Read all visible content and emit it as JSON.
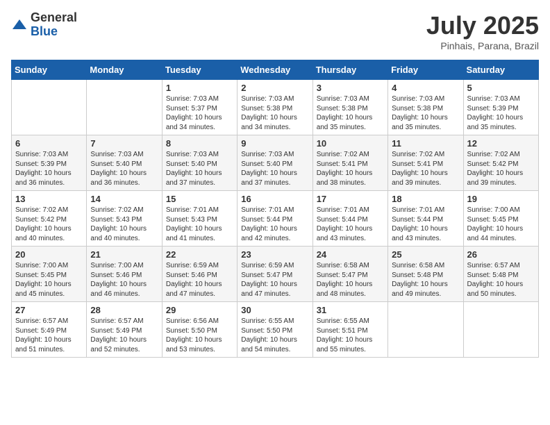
{
  "logo": {
    "general": "General",
    "blue": "Blue"
  },
  "title": "July 2025",
  "subtitle": "Pinhais, Parana, Brazil",
  "days_of_week": [
    "Sunday",
    "Monday",
    "Tuesday",
    "Wednesday",
    "Thursday",
    "Friday",
    "Saturday"
  ],
  "weeks": [
    [
      {
        "day": "",
        "info": ""
      },
      {
        "day": "",
        "info": ""
      },
      {
        "day": "1",
        "info": "Sunrise: 7:03 AM\nSunset: 5:37 PM\nDaylight: 10 hours and 34 minutes."
      },
      {
        "day": "2",
        "info": "Sunrise: 7:03 AM\nSunset: 5:38 PM\nDaylight: 10 hours and 34 minutes."
      },
      {
        "day": "3",
        "info": "Sunrise: 7:03 AM\nSunset: 5:38 PM\nDaylight: 10 hours and 35 minutes."
      },
      {
        "day": "4",
        "info": "Sunrise: 7:03 AM\nSunset: 5:38 PM\nDaylight: 10 hours and 35 minutes."
      },
      {
        "day": "5",
        "info": "Sunrise: 7:03 AM\nSunset: 5:39 PM\nDaylight: 10 hours and 35 minutes."
      }
    ],
    [
      {
        "day": "6",
        "info": "Sunrise: 7:03 AM\nSunset: 5:39 PM\nDaylight: 10 hours and 36 minutes."
      },
      {
        "day": "7",
        "info": "Sunrise: 7:03 AM\nSunset: 5:40 PM\nDaylight: 10 hours and 36 minutes."
      },
      {
        "day": "8",
        "info": "Sunrise: 7:03 AM\nSunset: 5:40 PM\nDaylight: 10 hours and 37 minutes."
      },
      {
        "day": "9",
        "info": "Sunrise: 7:03 AM\nSunset: 5:40 PM\nDaylight: 10 hours and 37 minutes."
      },
      {
        "day": "10",
        "info": "Sunrise: 7:02 AM\nSunset: 5:41 PM\nDaylight: 10 hours and 38 minutes."
      },
      {
        "day": "11",
        "info": "Sunrise: 7:02 AM\nSunset: 5:41 PM\nDaylight: 10 hours and 39 minutes."
      },
      {
        "day": "12",
        "info": "Sunrise: 7:02 AM\nSunset: 5:42 PM\nDaylight: 10 hours and 39 minutes."
      }
    ],
    [
      {
        "day": "13",
        "info": "Sunrise: 7:02 AM\nSunset: 5:42 PM\nDaylight: 10 hours and 40 minutes."
      },
      {
        "day": "14",
        "info": "Sunrise: 7:02 AM\nSunset: 5:43 PM\nDaylight: 10 hours and 40 minutes."
      },
      {
        "day": "15",
        "info": "Sunrise: 7:01 AM\nSunset: 5:43 PM\nDaylight: 10 hours and 41 minutes."
      },
      {
        "day": "16",
        "info": "Sunrise: 7:01 AM\nSunset: 5:44 PM\nDaylight: 10 hours and 42 minutes."
      },
      {
        "day": "17",
        "info": "Sunrise: 7:01 AM\nSunset: 5:44 PM\nDaylight: 10 hours and 43 minutes."
      },
      {
        "day": "18",
        "info": "Sunrise: 7:01 AM\nSunset: 5:44 PM\nDaylight: 10 hours and 43 minutes."
      },
      {
        "day": "19",
        "info": "Sunrise: 7:00 AM\nSunset: 5:45 PM\nDaylight: 10 hours and 44 minutes."
      }
    ],
    [
      {
        "day": "20",
        "info": "Sunrise: 7:00 AM\nSunset: 5:45 PM\nDaylight: 10 hours and 45 minutes."
      },
      {
        "day": "21",
        "info": "Sunrise: 7:00 AM\nSunset: 5:46 PM\nDaylight: 10 hours and 46 minutes."
      },
      {
        "day": "22",
        "info": "Sunrise: 6:59 AM\nSunset: 5:46 PM\nDaylight: 10 hours and 47 minutes."
      },
      {
        "day": "23",
        "info": "Sunrise: 6:59 AM\nSunset: 5:47 PM\nDaylight: 10 hours and 47 minutes."
      },
      {
        "day": "24",
        "info": "Sunrise: 6:58 AM\nSunset: 5:47 PM\nDaylight: 10 hours and 48 minutes."
      },
      {
        "day": "25",
        "info": "Sunrise: 6:58 AM\nSunset: 5:48 PM\nDaylight: 10 hours and 49 minutes."
      },
      {
        "day": "26",
        "info": "Sunrise: 6:57 AM\nSunset: 5:48 PM\nDaylight: 10 hours and 50 minutes."
      }
    ],
    [
      {
        "day": "27",
        "info": "Sunrise: 6:57 AM\nSunset: 5:49 PM\nDaylight: 10 hours and 51 minutes."
      },
      {
        "day": "28",
        "info": "Sunrise: 6:57 AM\nSunset: 5:49 PM\nDaylight: 10 hours and 52 minutes."
      },
      {
        "day": "29",
        "info": "Sunrise: 6:56 AM\nSunset: 5:50 PM\nDaylight: 10 hours and 53 minutes."
      },
      {
        "day": "30",
        "info": "Sunrise: 6:55 AM\nSunset: 5:50 PM\nDaylight: 10 hours and 54 minutes."
      },
      {
        "day": "31",
        "info": "Sunrise: 6:55 AM\nSunset: 5:51 PM\nDaylight: 10 hours and 55 minutes."
      },
      {
        "day": "",
        "info": ""
      },
      {
        "day": "",
        "info": ""
      }
    ]
  ]
}
